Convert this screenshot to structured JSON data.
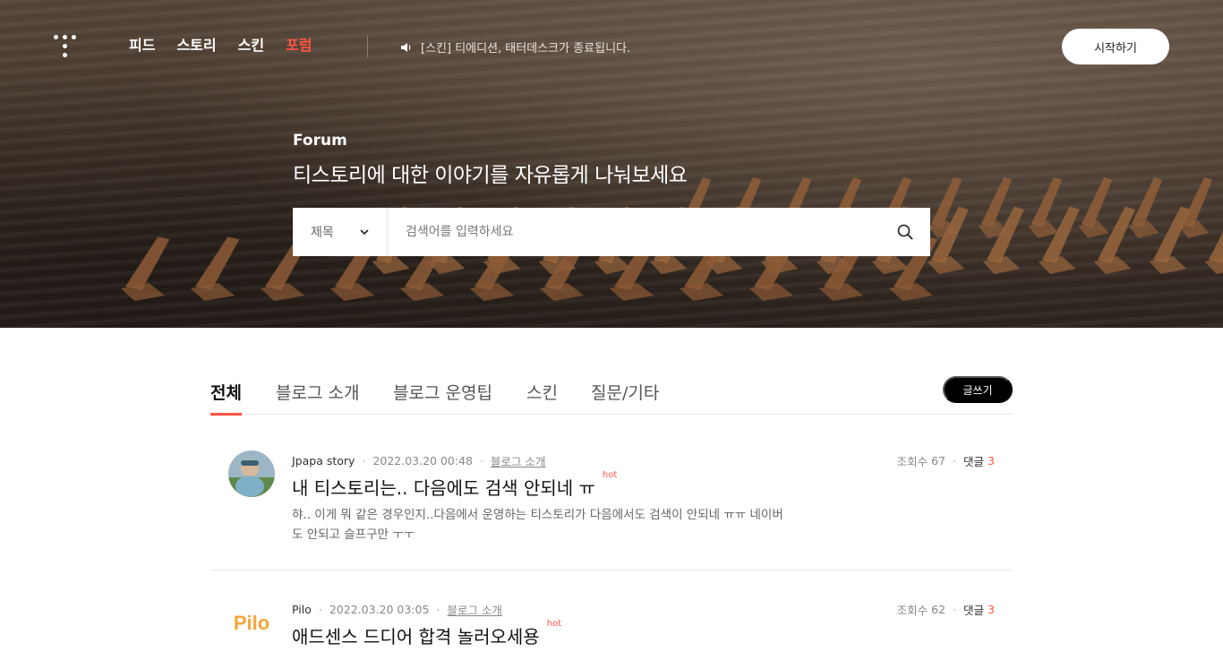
{
  "header": {
    "nav": [
      {
        "label": "피드",
        "active": false
      },
      {
        "label": "스토리",
        "active": false
      },
      {
        "label": "스킨",
        "active": false
      },
      {
        "label": "포럼",
        "active": true
      }
    ],
    "notice": "[스킨] 티에디션, 태터데스크가 종료됩니다.",
    "start_label": "시작하기",
    "accent_color": "#ff5544"
  },
  "hero": {
    "label": "Forum",
    "title": "티스토리에 대한 이야기를 자유롭게 나눠보세요"
  },
  "search": {
    "select_value": "제목",
    "placeholder": "검색어를 입력하세요"
  },
  "tabs": [
    {
      "label": "전체",
      "active": true
    },
    {
      "label": "블로그 소개",
      "active": false
    },
    {
      "label": "블로그 운영팁",
      "active": false
    },
    {
      "label": "스킨",
      "active": false
    },
    {
      "label": "질문/기타",
      "active": false
    }
  ],
  "write_label": "글쓰기",
  "posts": [
    {
      "author": "Jpapa story",
      "date": "2022.03.20 00:48",
      "category": "블로그 소개",
      "title": "내 티스토리는.. 다음에도 검색 안되네 ㅠ",
      "badge": "hot",
      "excerpt": "햐.. 이게 뭐 같은 경우인지..다음에서 운영하는 티스토리가 다음에서도 검색이 안되네 ㅠㅠ 네이버도 안되고 슬프구만 ㅜㅜ",
      "views_label": "조회수",
      "views": "67",
      "comments_label": "댓글",
      "comments": "3"
    },
    {
      "author": "Pilo",
      "avatar_text": "Pilo",
      "date": "2022.03.20 03:05",
      "category": "블로그 소개",
      "title": "애드센스 드디어 합격 놀러오세용",
      "badge": "hot",
      "views_label": "조회수",
      "views": "62",
      "comments_label": "댓글",
      "comments": "3"
    }
  ]
}
